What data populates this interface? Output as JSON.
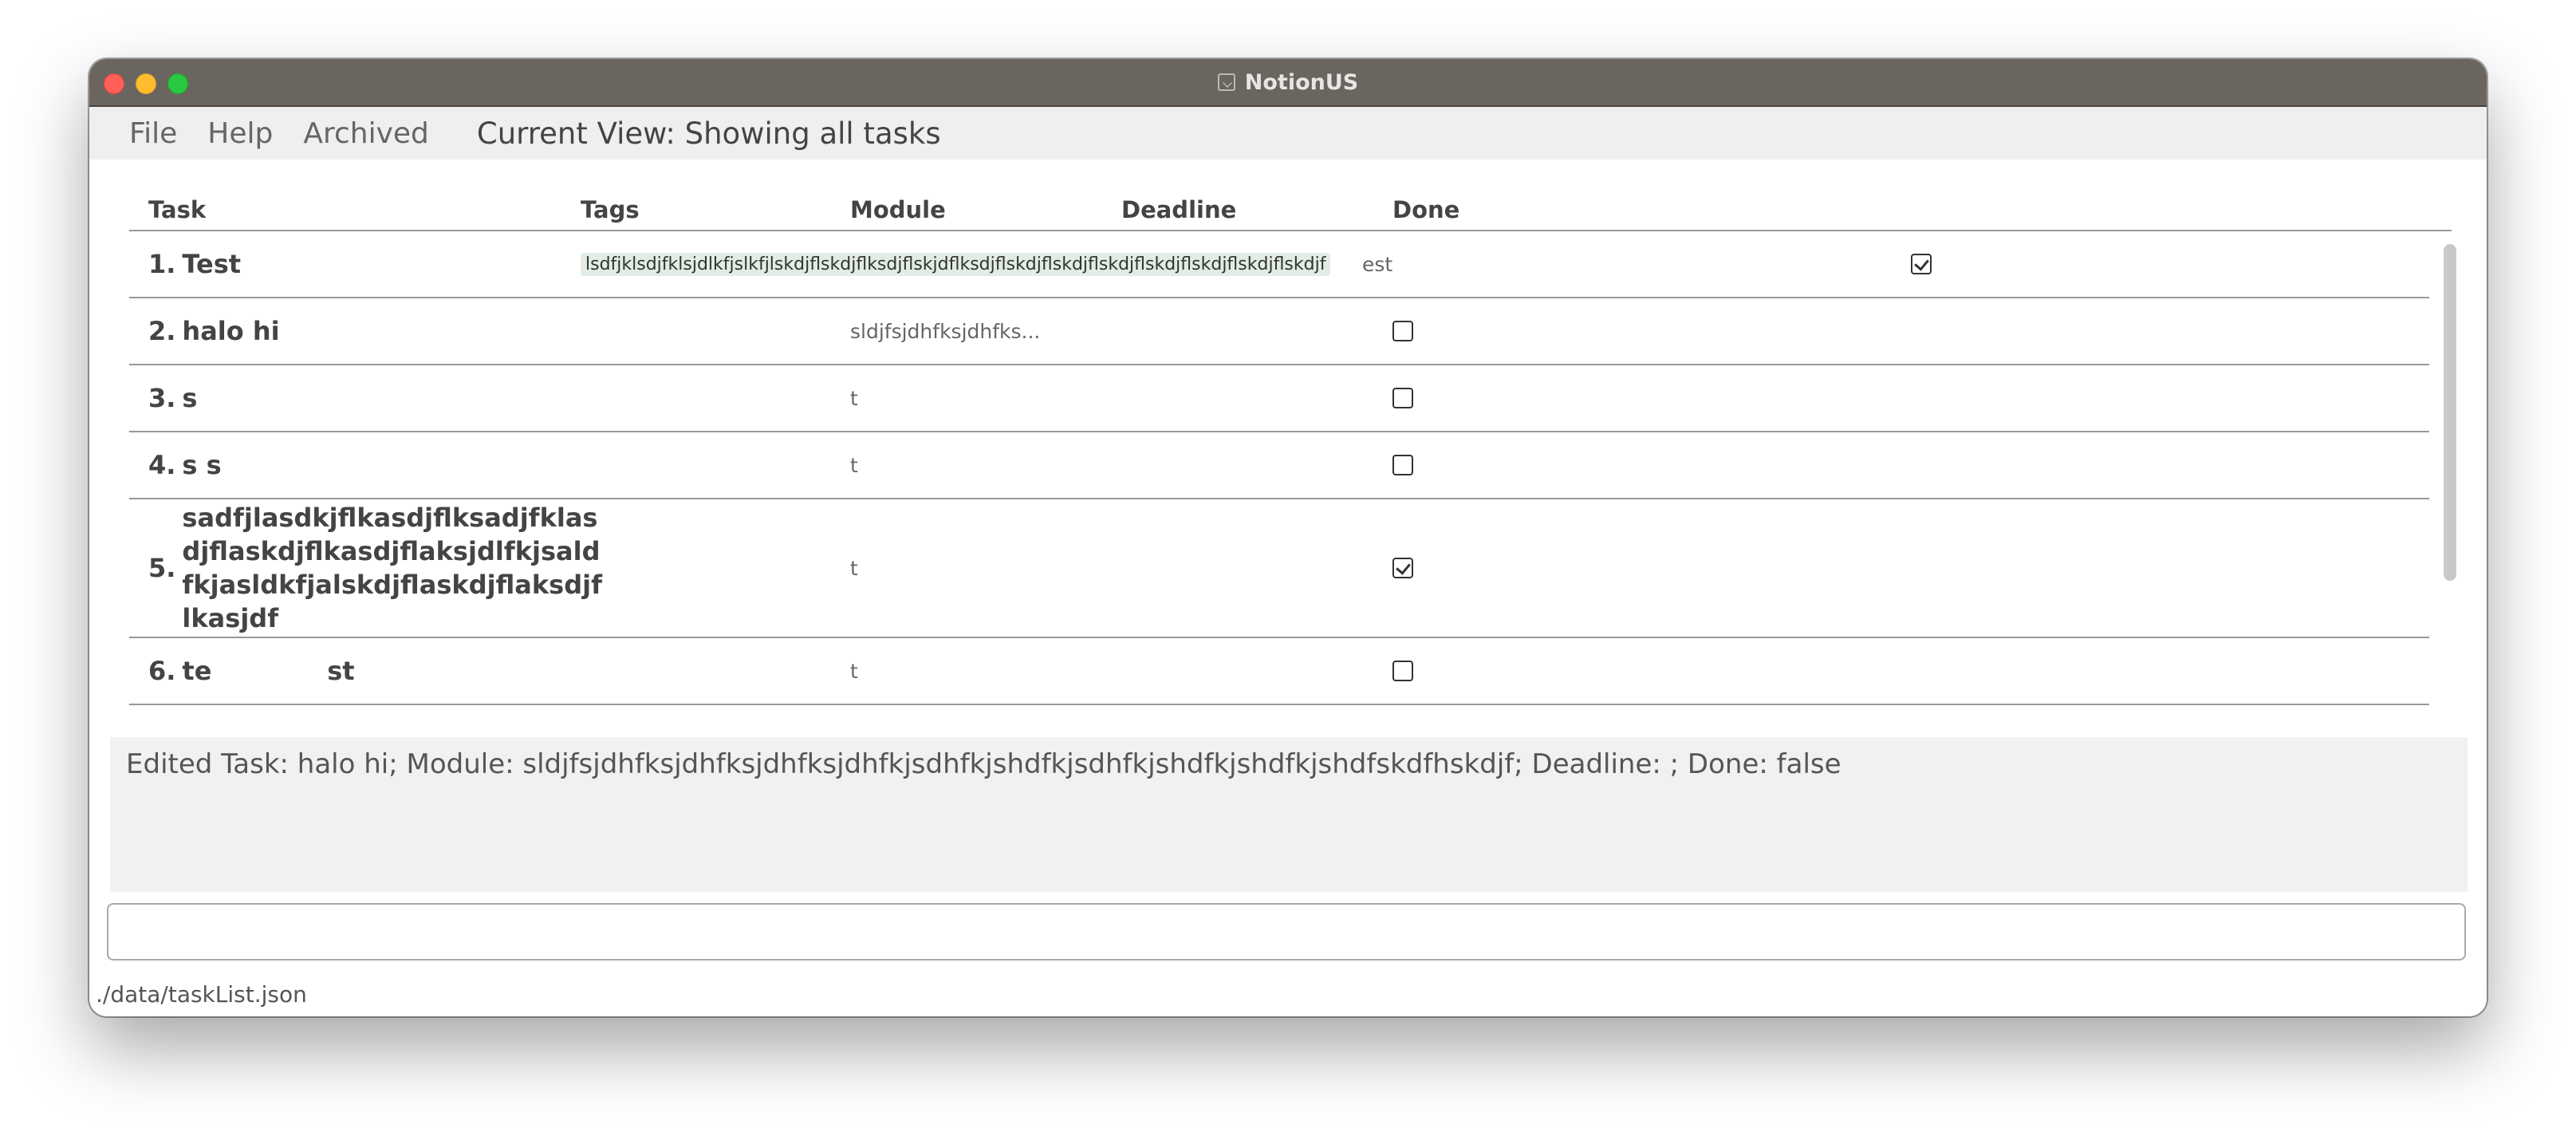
{
  "window": {
    "title": "NotionUS"
  },
  "menu": {
    "file": "File",
    "help": "Help",
    "archived": "Archived",
    "current_view": "Current View: Showing all tasks"
  },
  "table": {
    "headers": {
      "task": "Task",
      "tags": "Tags",
      "module": "Module",
      "deadline": "Deadline",
      "done": "Done"
    },
    "rows": [
      {
        "number": "1.",
        "name": "Test",
        "tag": "lsdfjklsdjfklsjdlkfjslkfjlskdjflskdjflksdjflskjdflksdjflskdjflskdjflskdjflskdjflskdjflskdjflskdjf",
        "module": "",
        "deadline": "est",
        "done": true
      },
      {
        "number": "2.",
        "name": "halo hi",
        "tag": "",
        "module": "sldjfsjdhfksjdhfks...",
        "deadline": "",
        "done": false
      },
      {
        "number": "3.",
        "name": "s",
        "tag": "",
        "module": "t",
        "deadline": "",
        "done": false
      },
      {
        "number": "4.",
        "name": "s s",
        "tag": "",
        "module": "t",
        "deadline": "",
        "done": false
      },
      {
        "number": "5.",
        "name_lines": [
          "sadfjlasdkjflkasdjflksadjfklas",
          "djflaskdjflkasdjflaksjdlfkjsald",
          "fkjasldkfjalskdjflaskdjflaksdjf",
          "lkasjdf"
        ],
        "tag": "",
        "module": "t",
        "deadline": "",
        "done": true
      },
      {
        "number": "6.",
        "name": "te             st",
        "tag": "",
        "module": "t",
        "deadline": "",
        "done": false
      }
    ]
  },
  "result": {
    "text": "Edited Task: halo hi; Module: sldjfsjdhfksjdhfksjdhfksjdhfkjsdhfkjshdfkjsdhfkjshdfkjshdfkjshdfskdfhskdjf; Deadline: ; Done: false"
  },
  "command": {
    "value": ""
  },
  "status": {
    "path": "./data/taskList.json"
  }
}
